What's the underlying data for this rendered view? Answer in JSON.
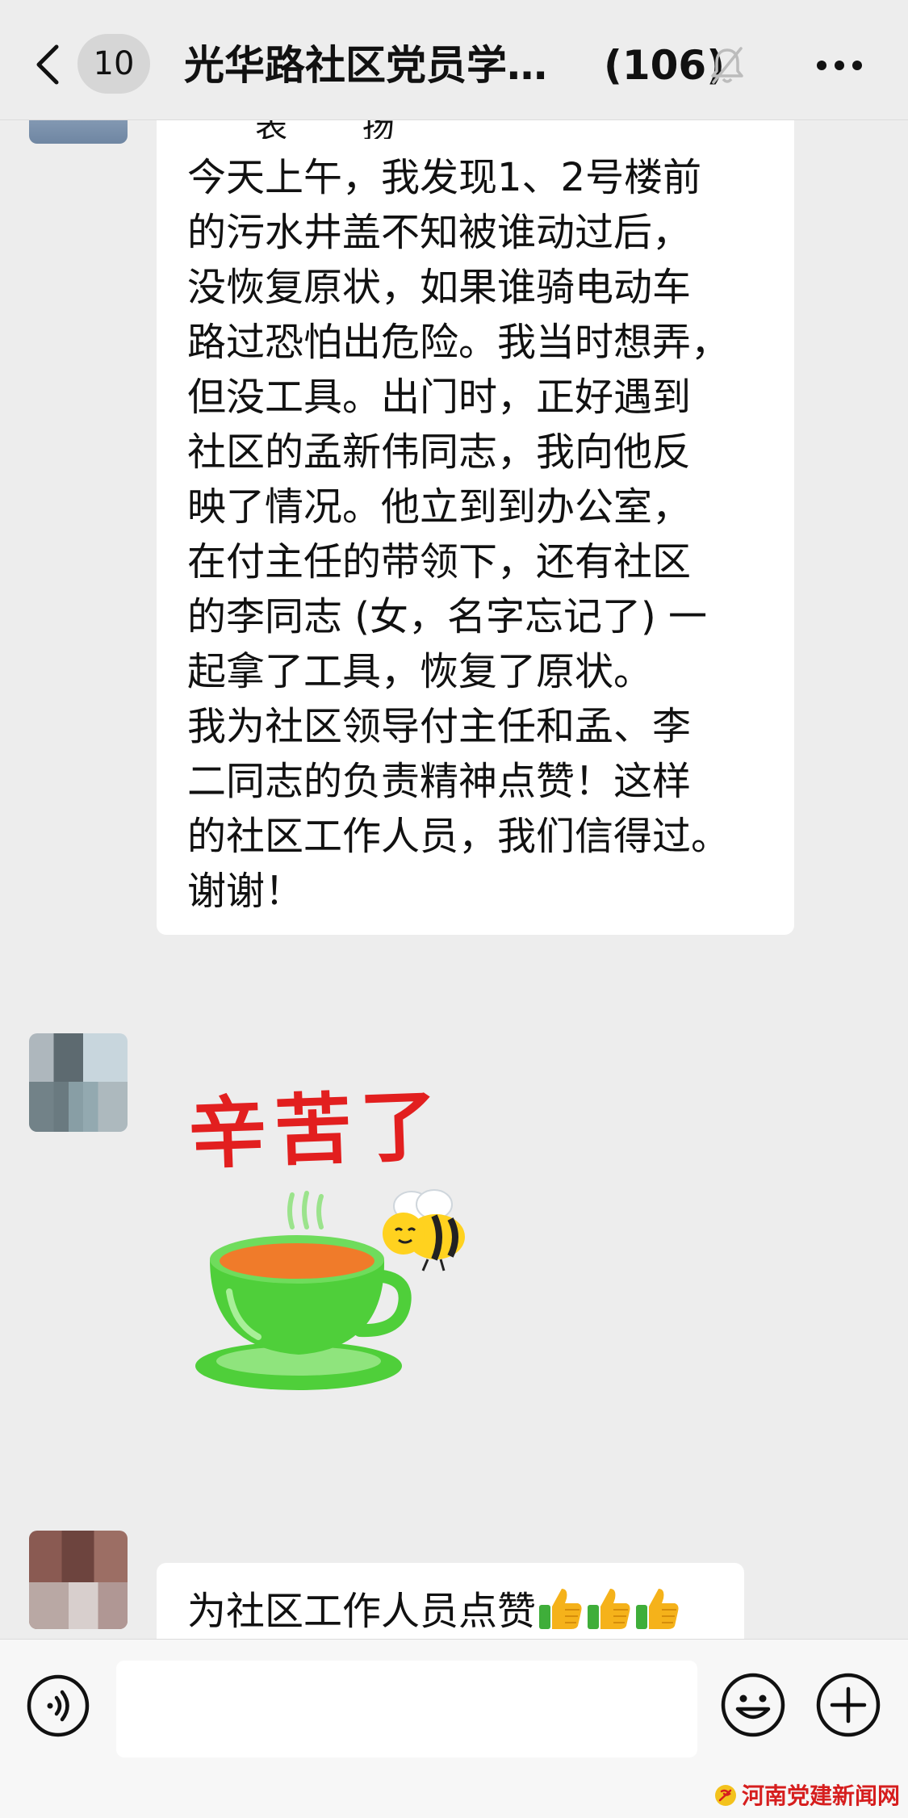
{
  "header": {
    "unread_count": "10",
    "chat_title": "光华路社区党员学…",
    "member_count": "(106)"
  },
  "messages": [
    {
      "type": "text",
      "partial_top_line": "表 扬",
      "lines": [
        "今天上午，我发现1、2号楼前",
        "的污水井盖不知被谁动过后，",
        "没恢复原状，如果谁骑电动车",
        "路过恐怕出危险。我当时想弄，",
        "但没工具。出门时，正好遇到",
        "社区的孟新伟同志，我向他反",
        "映了情况。他立到到办公室，",
        "在付主任的带领下，还有社区",
        "的李同志 (女，名字忘记了) 一",
        "起拿了工具，恢复了原状。",
        "我为社区领导付主任和孟、李",
        "二同志的负责精神点赞！这样",
        "的社区工作人员，我们信得过。",
        "谢谢！"
      ]
    },
    {
      "type": "sticker",
      "sticker_text": "辛苦了",
      "icons": [
        "green-teacup-icon",
        "bee-icon"
      ]
    },
    {
      "type": "text",
      "text": "为社区工作人员点赞",
      "emoji": [
        "thumbs-up-icon",
        "thumbs-up-icon",
        "thumbs-up-icon"
      ]
    }
  ],
  "input_bar": {
    "placeholder": "",
    "icons": [
      "voice-icon",
      "emoji-icon",
      "plus-icon"
    ]
  },
  "watermark": "河南党建新闻网",
  "colors": {
    "background": "#ededed",
    "bubble": "#ffffff",
    "sticker_red": "#e21f1f",
    "teacup_green": "#4fcf3a",
    "watermark_red": "#d61e1e"
  }
}
